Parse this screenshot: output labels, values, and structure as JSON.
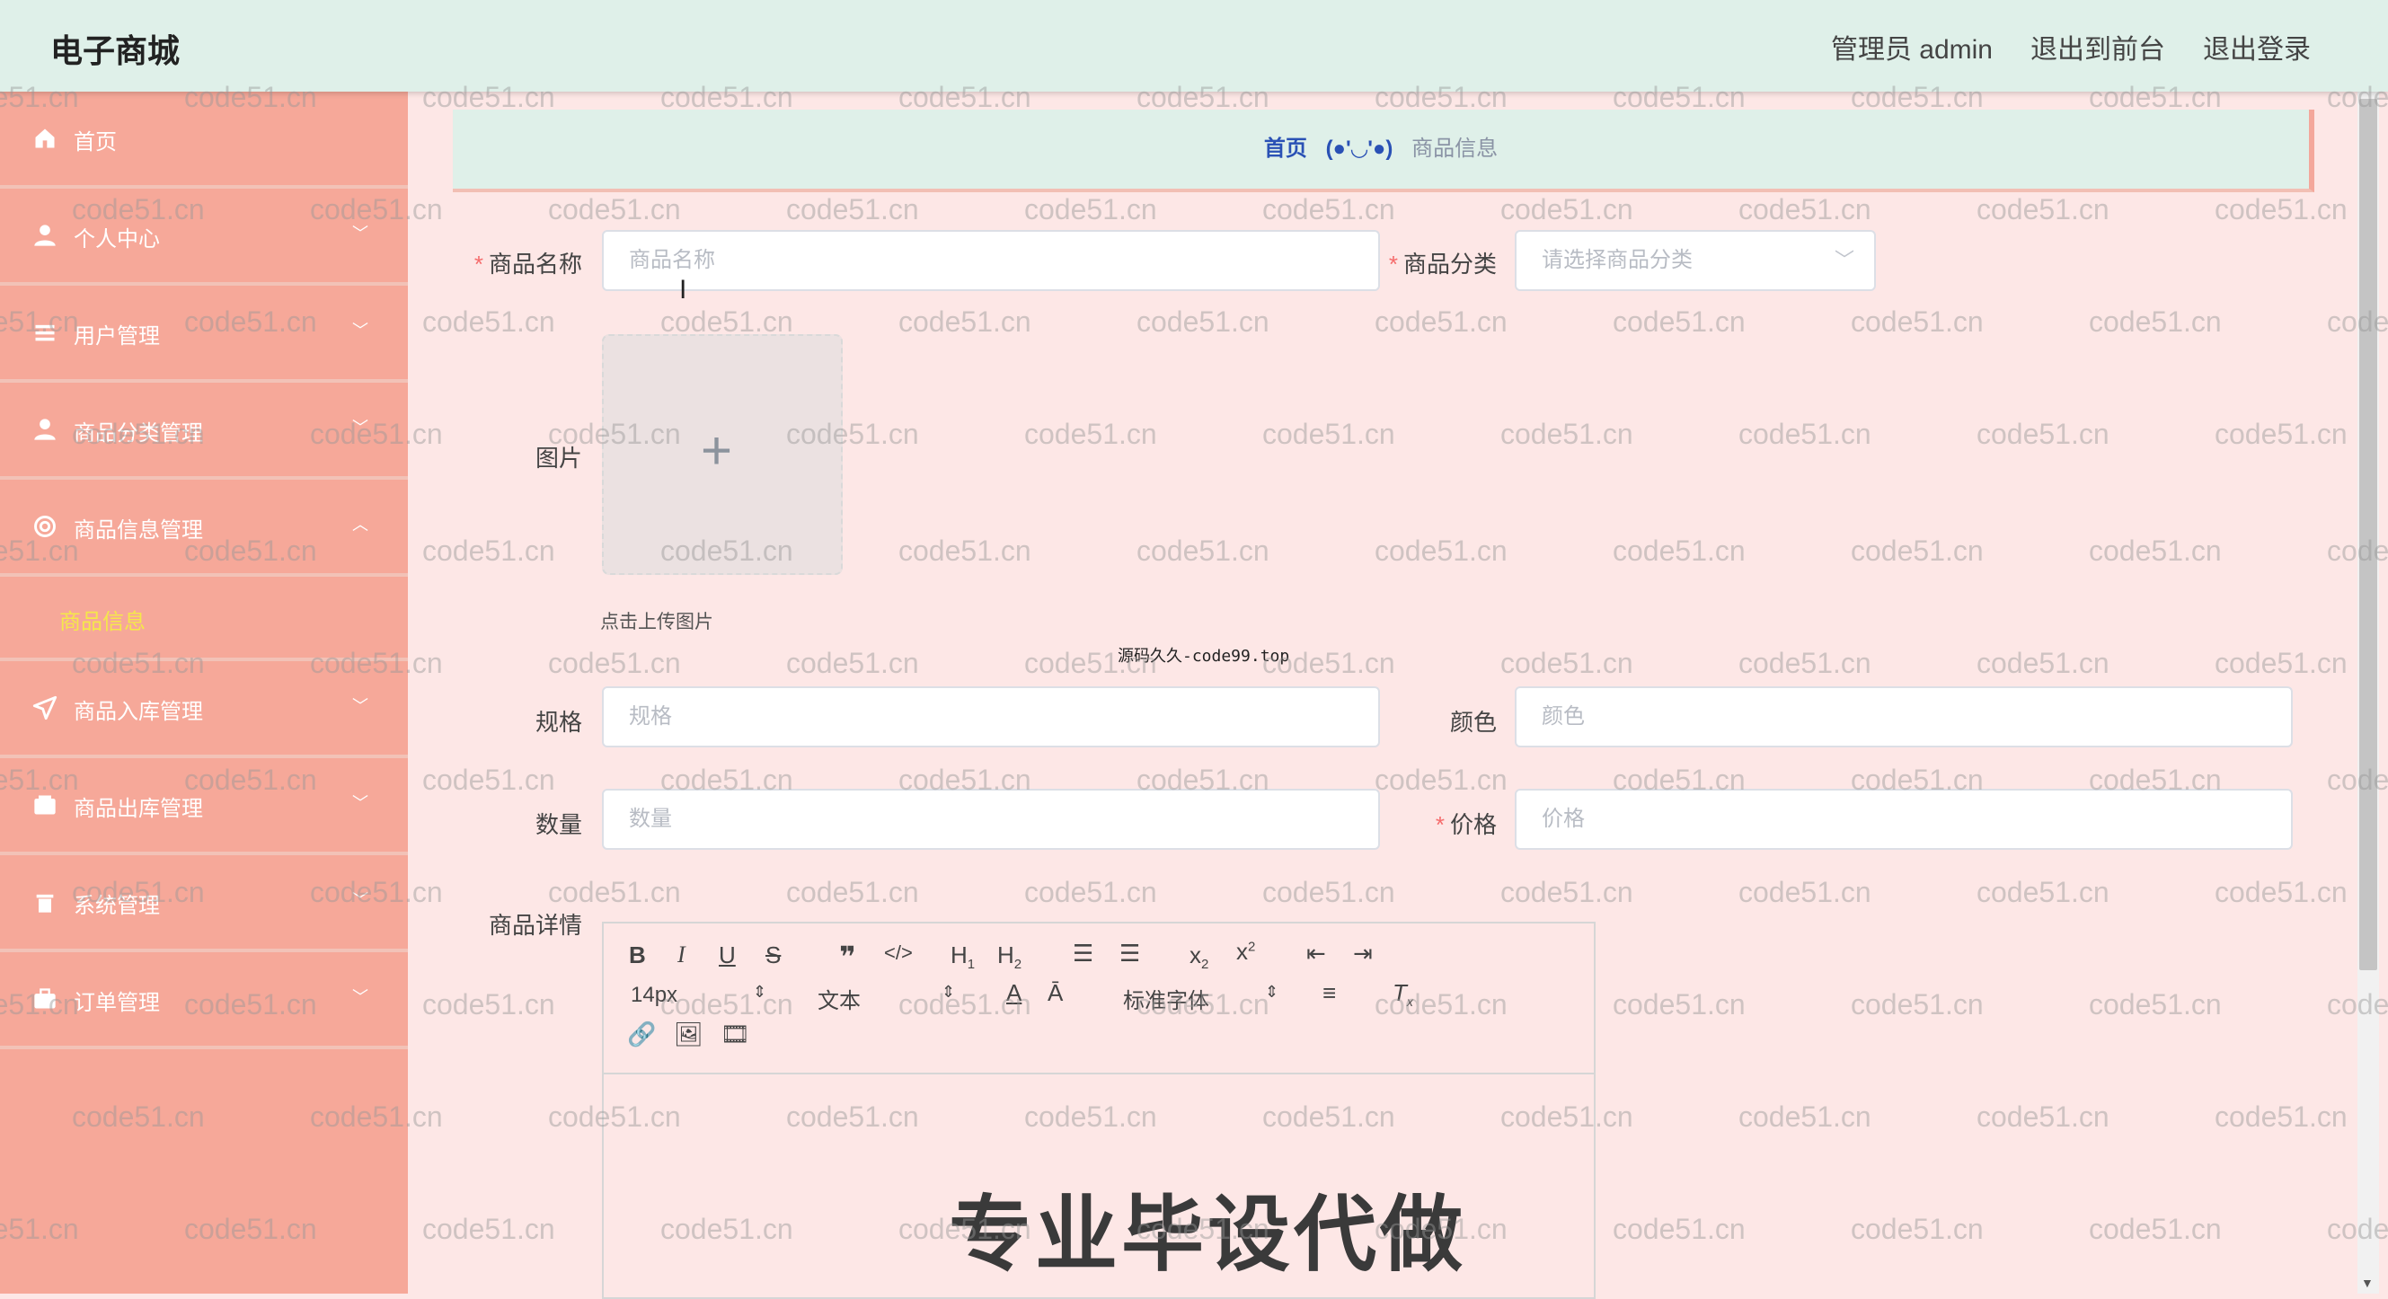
{
  "header": {
    "brand": "电子商城",
    "user": "管理员 admin",
    "to_front": "退出到前台",
    "logout": "退出登录"
  },
  "sidebar": {
    "items": [
      {
        "label": "首页",
        "icon": "home-icon"
      },
      {
        "label": "个人中心",
        "icon": "user-icon"
      },
      {
        "label": "用户管理",
        "icon": "list-icon"
      },
      {
        "label": "商品分类管理",
        "icon": "user-icon"
      },
      {
        "label": "商品信息管理",
        "icon": "circle-icon"
      },
      {
        "label": "商品入库管理",
        "icon": "send-icon"
      },
      {
        "label": "商品出库管理",
        "icon": "wallet-icon"
      },
      {
        "label": "系统管理",
        "icon": "trash-icon"
      },
      {
        "label": "订单管理",
        "icon": "briefcase-icon"
      }
    ],
    "active_sub": "商品信息"
  },
  "breadcrumb": {
    "home": "首页",
    "sep": "(●'◡'●)",
    "current": "商品信息"
  },
  "form": {
    "name_label": "商品名称",
    "name_placeholder": "商品名称",
    "category_label": "商品分类",
    "category_placeholder": "请选择商品分类",
    "image_label": "图片",
    "upload_tip": "点击上传图片",
    "spec_label": "规格",
    "spec_placeholder": "规格",
    "color_label": "颜色",
    "color_placeholder": "颜色",
    "qty_label": "数量",
    "qty_placeholder": "数量",
    "price_label": "价格",
    "price_placeholder": "价格",
    "detail_label": "商品详情"
  },
  "editor": {
    "font_size": "14px",
    "block_type": "文本",
    "font_family": "标准字体"
  },
  "watermarks": {
    "site": "code51.cn",
    "tip": "源码久久-code99.top",
    "promo": "专业毕设代做"
  }
}
